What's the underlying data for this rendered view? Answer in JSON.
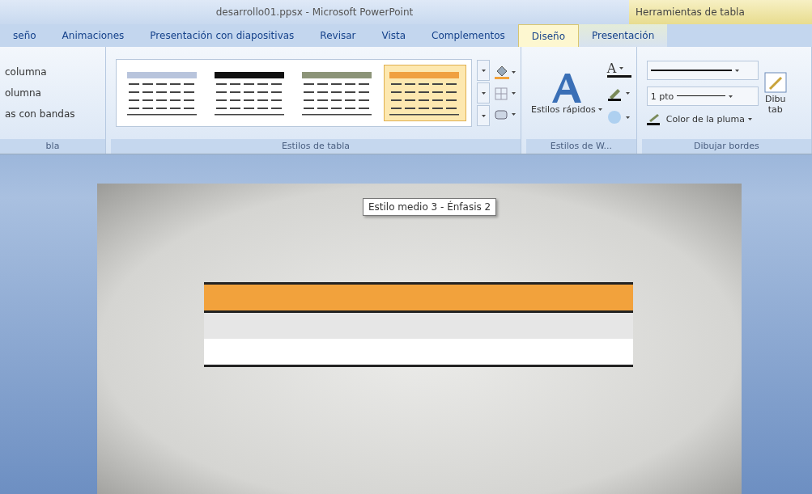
{
  "window": {
    "title": "desarrollo01.ppsx - Microsoft PowerPoint",
    "context_header": "Herramientas de tabla"
  },
  "tabs": [
    {
      "label": "seño",
      "selected": false,
      "contextual": false
    },
    {
      "label": "Animaciones",
      "selected": false,
      "contextual": false
    },
    {
      "label": "Presentación con diapositivas",
      "selected": false,
      "contextual": false
    },
    {
      "label": "Revisar",
      "selected": false,
      "contextual": false
    },
    {
      "label": "Vista",
      "selected": false,
      "contextual": false
    },
    {
      "label": "Complementos",
      "selected": false,
      "contextual": false
    },
    {
      "label": "Diseño",
      "selected": true,
      "contextual": true
    },
    {
      "label": "Presentación",
      "selected": false,
      "contextual": true
    }
  ],
  "ribbon": {
    "options_group": {
      "items": [
        "columna",
        "olumna",
        "as con bandas"
      ],
      "label": "bla"
    },
    "styles_group": {
      "label": "Estilos de tabla",
      "styles": [
        {
          "color": "#b8c4dc",
          "selected": false
        },
        {
          "color": "#111111",
          "selected": false
        },
        {
          "color": "#8c9478",
          "selected": false
        },
        {
          "color": "#f0a040",
          "selected": true
        }
      ]
    },
    "wordart_group": {
      "button": "Estilos rápidos",
      "text_fill_glyph": "A",
      "label": "Estilos de W..."
    },
    "borders_group": {
      "pen_weight": "1 pto",
      "pen_color": "Color de la pluma",
      "draw_button": [
        "Dibu",
        "tab"
      ],
      "label": "Dibujar bordes"
    }
  },
  "tooltip": "Estilo medio 3 - Énfasis 2",
  "slide": {
    "table_rows": [
      {
        "kind": "header"
      },
      {
        "kind": "band"
      },
      {
        "kind": "plain"
      }
    ]
  }
}
